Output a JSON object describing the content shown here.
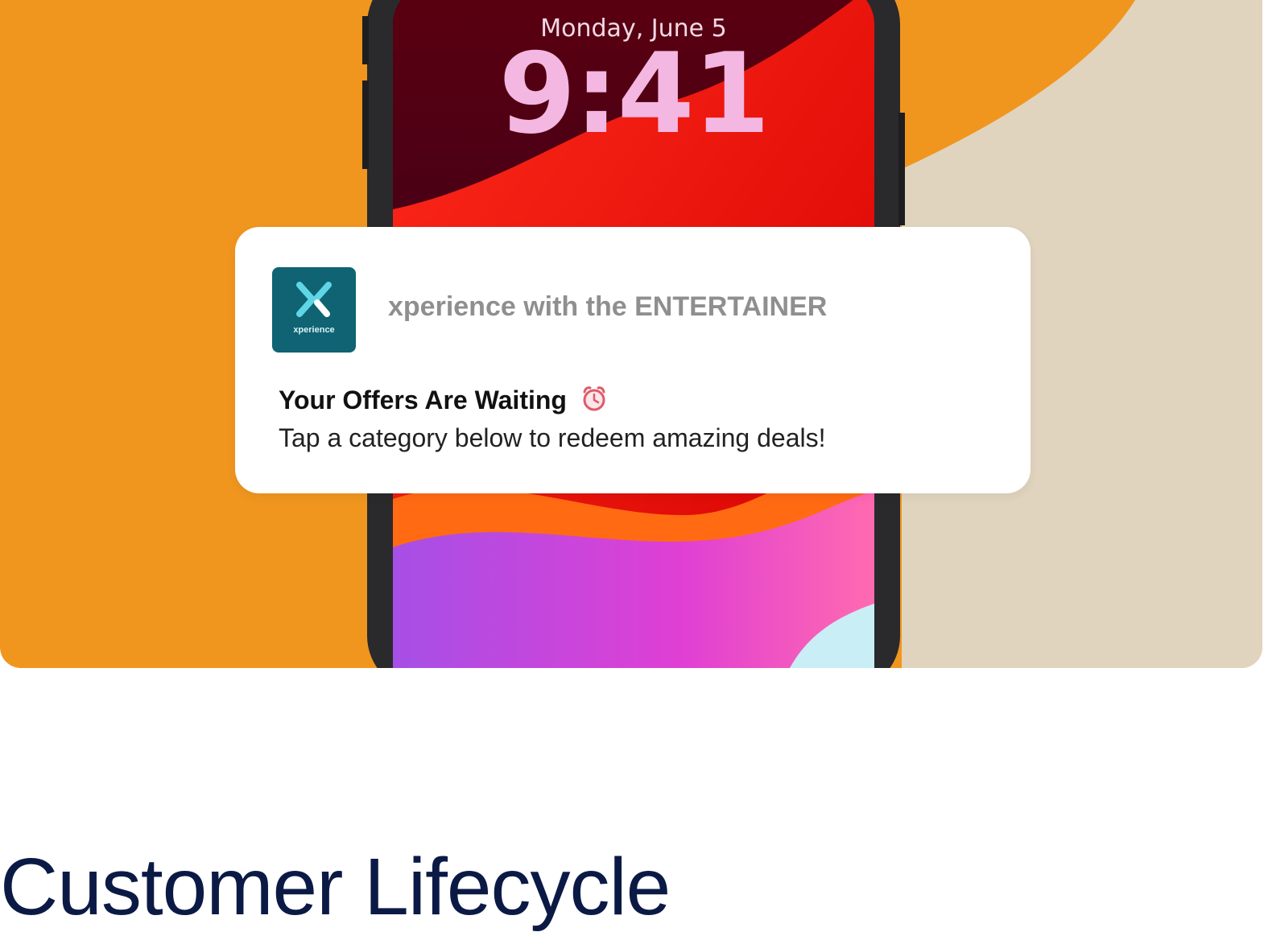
{
  "hero": {
    "lock_screen": {
      "date": "Monday, June 5",
      "time": "9:41"
    },
    "notification": {
      "app_icon_label": "xperience",
      "app_name": "xperience with the ENTERTAINER",
      "title": "Your Offers Are Waiting",
      "title_icon": "alarm-clock-icon",
      "body": "Tap a category below to redeem amazing deals!"
    }
  },
  "section": {
    "heading": "Customer Lifecycle"
  },
  "colors": {
    "hero_orange": "#F0961F",
    "hero_beige": "#E1D4BE",
    "app_icon_teal": "#0F6373",
    "heading_navy": "#0B1A45"
  }
}
